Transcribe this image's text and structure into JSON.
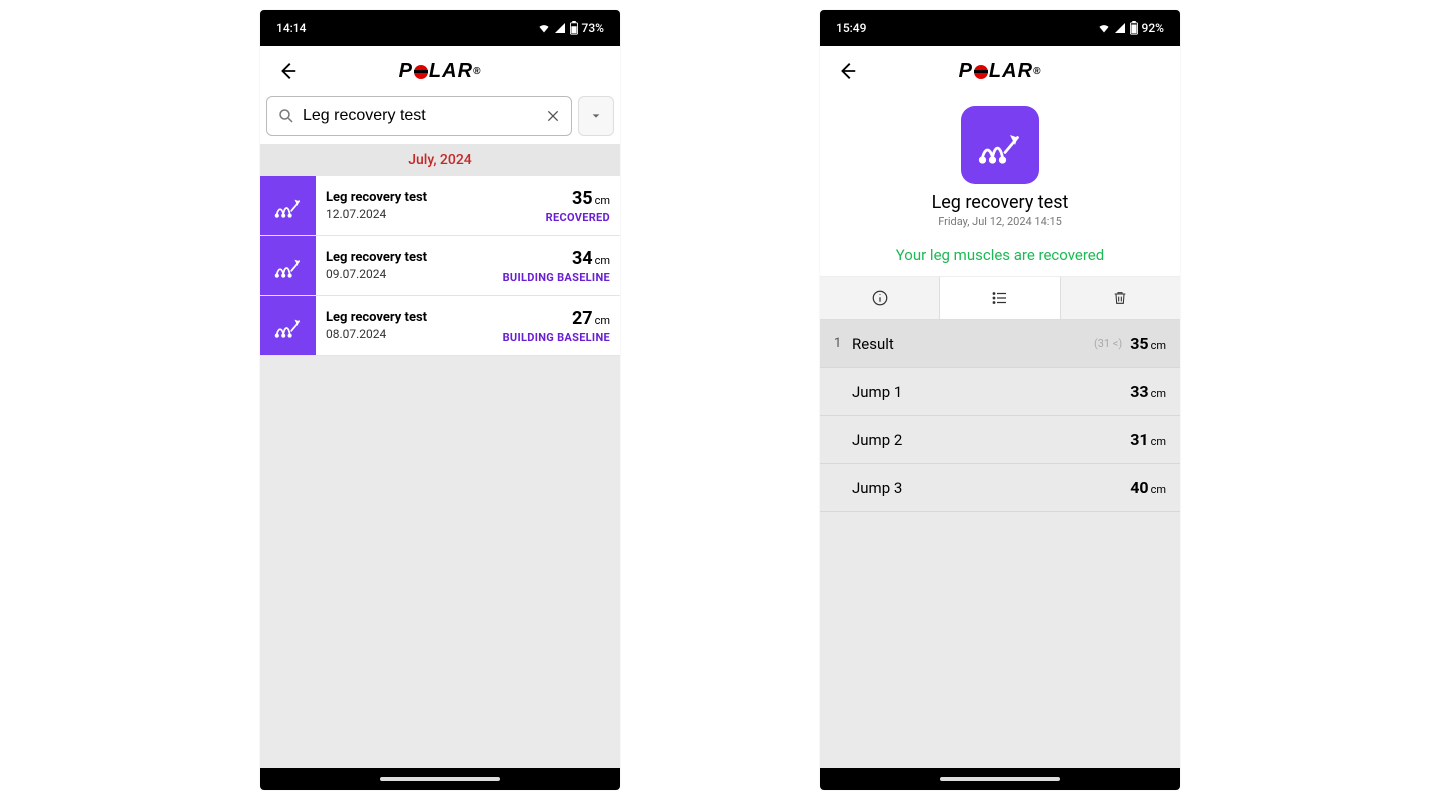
{
  "left": {
    "statusbar": {
      "time": "14:14",
      "battery": "73%"
    },
    "brand": "POLAR",
    "search": {
      "value": "Leg recovery test"
    },
    "month_header": "July, 2024",
    "items": [
      {
        "title": "Leg recovery test",
        "date": "12.07.2024",
        "value": "35",
        "unit": "cm",
        "status": "RECOVERED"
      },
      {
        "title": "Leg recovery test",
        "date": "09.07.2024",
        "value": "34",
        "unit": "cm",
        "status": "BUILDING BASELINE"
      },
      {
        "title": "Leg recovery test",
        "date": "08.07.2024",
        "value": "27",
        "unit": "cm",
        "status": "BUILDING BASELINE"
      }
    ]
  },
  "right": {
    "statusbar": {
      "time": "15:49",
      "battery": "92%"
    },
    "brand": "POLAR",
    "hero": {
      "title": "Leg recovery test",
      "subtitle": "Friday, Jul 12, 2024 14:15"
    },
    "message": "Your leg muscles are recovered",
    "result_header": {
      "index": "1",
      "label": "Result",
      "note": "(31 <)",
      "value": "35",
      "unit": "cm"
    },
    "jumps": [
      {
        "label": "Jump 1",
        "value": "33",
        "unit": "cm"
      },
      {
        "label": "Jump 2",
        "value": "31",
        "unit": "cm"
      },
      {
        "label": "Jump 3",
        "value": "40",
        "unit": "cm"
      }
    ]
  }
}
